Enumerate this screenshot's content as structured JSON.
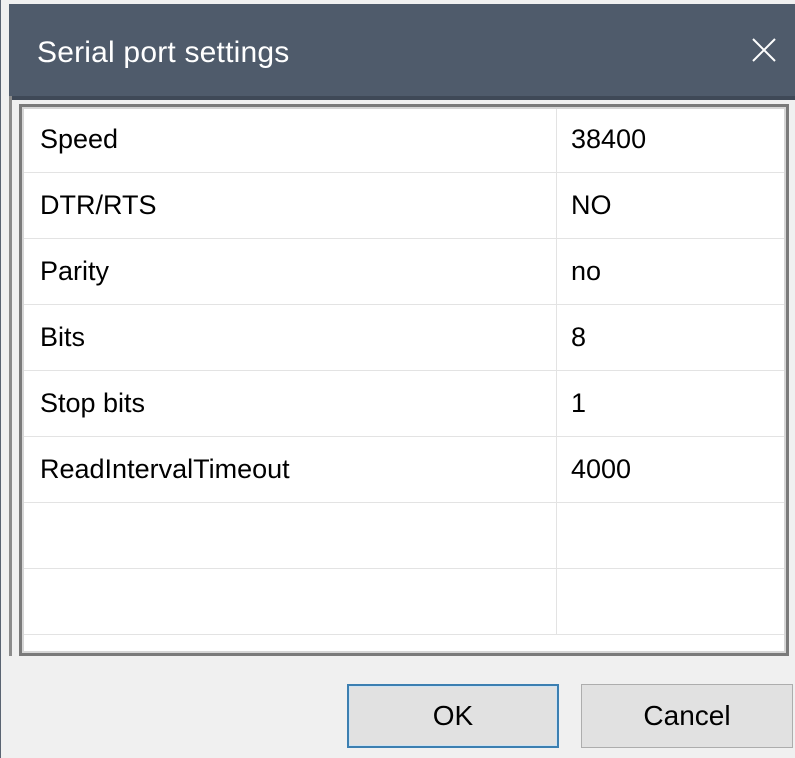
{
  "window": {
    "title": "Serial port settings",
    "close_icon": "close-icon"
  },
  "settings": {
    "rows": [
      {
        "name": "Speed",
        "value": "38400"
      },
      {
        "name": "DTR/RTS",
        "value": "NO"
      },
      {
        "name": "Parity",
        "value": "no"
      },
      {
        "name": "Bits",
        "value": "8"
      },
      {
        "name": "Stop bits",
        "value": "1"
      },
      {
        "name": "ReadIntervalTimeout",
        "value": "4000"
      },
      {
        "name": "",
        "value": ""
      },
      {
        "name": "",
        "value": ""
      }
    ]
  },
  "buttons": {
    "ok_label": "OK",
    "cancel_label": "Cancel"
  },
  "colors": {
    "titlebar": "#4f5b6b",
    "dialog_bg": "#f0f0f0",
    "default_button_border": "#3c7fb1"
  }
}
